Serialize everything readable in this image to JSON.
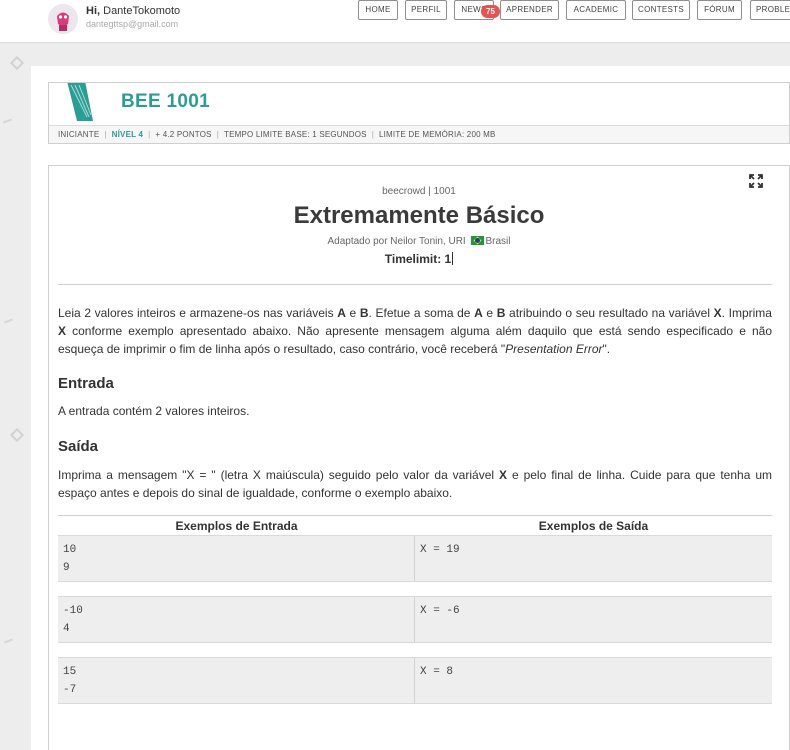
{
  "header": {
    "greeting": "Hi,",
    "username": "DanteTokomoto",
    "email": "dantegttsp@gmail.com",
    "nav": [
      {
        "label": "HOME"
      },
      {
        "label": "PERFIL"
      },
      {
        "label": "NEWS"
      },
      {
        "label": "APRENDER"
      },
      {
        "label": "ACADEMIC"
      },
      {
        "label": "CONTESTS"
      },
      {
        "label": "FÓRUM"
      },
      {
        "label": "PROBLE"
      }
    ],
    "news_badge": "75"
  },
  "problem_header": {
    "code": "BEE 1001",
    "meta": {
      "category": "INICIANTE",
      "level": "NÍVEL 4",
      "points": "+ 4.2 PONTOS",
      "time_limit": "TEMPO LIMITE BASE: 1 SEGUNDOS",
      "memory_limit": "LIMITE DE MEMÓRIA: 200 MB"
    }
  },
  "statement": {
    "source": "beecrowd | 1001",
    "title": "Extremamente Básico",
    "author_prefix": "Adaptado por Neilor Tonin, URI",
    "author_country": "Brasil",
    "timelimit": "Timelimit: 1",
    "description": {
      "t1": "Leia 2 valores inteiros e armazene-os nas variáveis ",
      "b1": "A",
      "t2": " e ",
      "b2": "B",
      "t3": ". Efetue a soma de ",
      "b3": "A",
      "t4": " e ",
      "b4": "B",
      "t5": " atribuindo o seu resultado na variável ",
      "b5": "X",
      "t6": ". Imprima ",
      "b6": "X",
      "t7": " conforme exemplo apresentado abaixo. Não apresente mensagem alguma além daquilo que está sendo especificado e não esqueça de imprimir o fim de linha após o resultado, caso contrário, você receberá \"",
      "i1": "Presentation Error",
      "t8": "\"."
    },
    "input_title": "Entrada",
    "input_text": "A entrada contém 2 valores inteiros.",
    "output_title": "Saída",
    "output": {
      "t1": "Imprima a mensagem \"X = \" (letra X maiúscula) seguido pelo valor da variável ",
      "b1": "X",
      "t2": " e pelo final de linha. Cuide para que tenha um espaço antes e depois do sinal de igualdade, conforme o exemplo abaixo."
    },
    "examples": {
      "input_header": "Exemplos de Entrada",
      "output_header": "Exemplos de Saída",
      "rows": [
        {
          "input": "10\n9",
          "output": "X = 19"
        },
        {
          "input": "-10\n4",
          "output": "X = -6"
        },
        {
          "input": "15\n-7",
          "output": "X = 8"
        }
      ]
    }
  },
  "colors": {
    "accent": "#2a9d95",
    "badge": "#e8534f"
  }
}
